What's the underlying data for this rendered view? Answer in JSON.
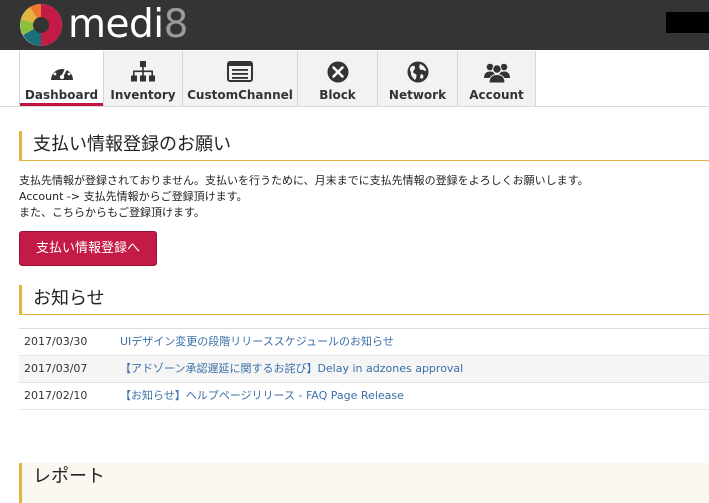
{
  "brand": {
    "name_prefix": "medi",
    "name_suffix": "8"
  },
  "nav": {
    "items": [
      {
        "label": "Dashboard",
        "icon": "gauge-icon"
      },
      {
        "label": "Inventory",
        "icon": "sitemap-icon"
      },
      {
        "label": "CustomChannel",
        "icon": "list-window-icon"
      },
      {
        "label": "Block",
        "icon": "block-icon"
      },
      {
        "label": "Network",
        "icon": "globe-icon"
      },
      {
        "label": "Account",
        "icon": "users-icon"
      }
    ],
    "active": "Dashboard"
  },
  "payment_section": {
    "title": "支払い情報登録のお願い",
    "lines": [
      "支払先情報が登録されておりません。支払いを行うために、月末までに支払先情報の登録をよろしくお願いします。",
      "Account -> 支払先情報からご登録頂けます。",
      "また、こちらからもご登録頂けます。"
    ],
    "button_label": "支払い情報登録へ"
  },
  "news_section": {
    "title": "お知らせ",
    "rows": [
      {
        "date": "2017/03/30",
        "title": "UIデザイン変更の段階リリーススケジュールのお知らせ"
      },
      {
        "date": "2017/03/07",
        "title": "【アドゾーン承認遅延に関するお詫び】Delay in adzones approval"
      },
      {
        "date": "2017/02/10",
        "title": "【お知らせ】ヘルプページリリース - FAQ Page Release"
      }
    ]
  },
  "reports_section": {
    "title": "レポート"
  },
  "colors": {
    "accent": "#c41a46",
    "section_rule": "#e3b342",
    "link": "#3a6fa8",
    "topbar": "#343434"
  }
}
